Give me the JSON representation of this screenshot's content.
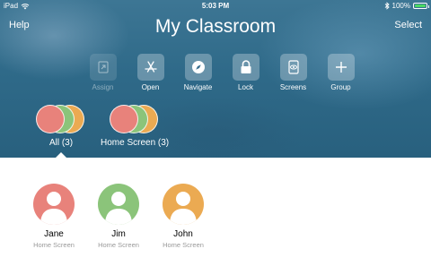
{
  "status": {
    "device": "iPad",
    "time": "5:03 PM",
    "battery_pct": "100%",
    "battery_level": 1.0
  },
  "nav": {
    "help": "Help",
    "title": "My Classroom",
    "select": "Select"
  },
  "tools": [
    {
      "label": "Assign",
      "icon": "assign-icon",
      "enabled": false
    },
    {
      "label": "Open",
      "icon": "app-store-icon",
      "enabled": true
    },
    {
      "label": "Navigate",
      "icon": "compass-icon",
      "enabled": true
    },
    {
      "label": "Lock",
      "icon": "lock-icon",
      "enabled": true
    },
    {
      "label": "Screens",
      "icon": "eye-screen-icon",
      "enabled": true
    },
    {
      "label": "Group",
      "icon": "plus-icon",
      "enabled": true
    }
  ],
  "groups": [
    {
      "label": "All (3)",
      "selected": true
    },
    {
      "label": "Home Screen (3)",
      "selected": false
    }
  ],
  "students": [
    {
      "name": "Jane",
      "subtitle": "Home Screen",
      "color": "#e8827b"
    },
    {
      "name": "Jim",
      "subtitle": "Home Screen",
      "color": "#8bc47a"
    },
    {
      "name": "John",
      "subtitle": "Home Screen",
      "color": "#ebaa52"
    }
  ],
  "colors": {
    "jane": "#e8827b",
    "jim": "#8bc47a",
    "john": "#ebaa52",
    "battery": "#4cd964"
  }
}
